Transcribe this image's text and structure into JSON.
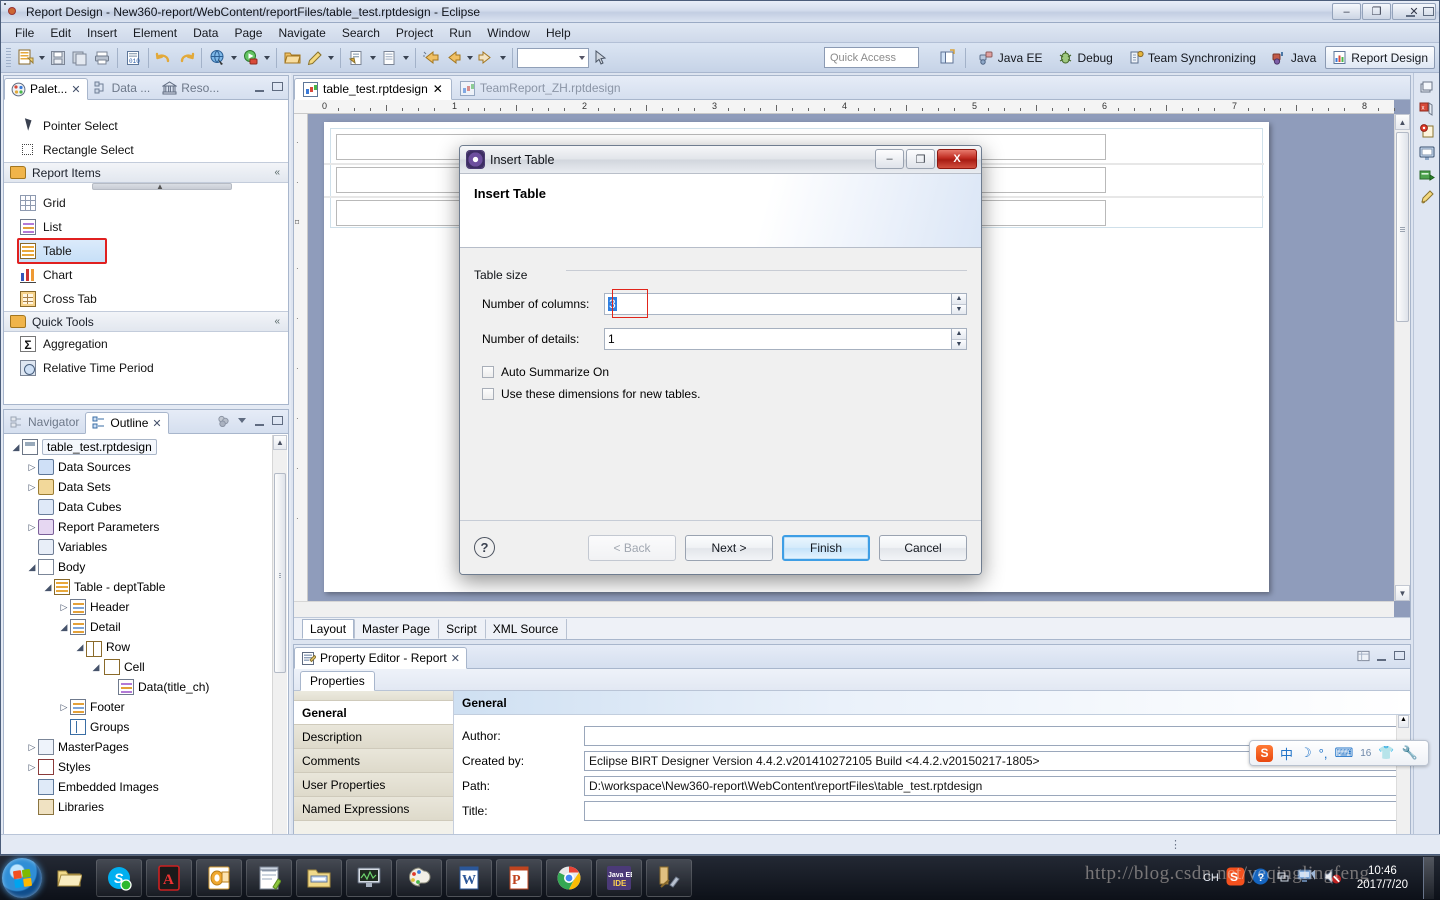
{
  "window": {
    "title": "Report Design - New360-report/WebContent/reportFiles/table_test.rptdesign - Eclipse",
    "minimize": "–",
    "restore": "❐",
    "close": "✕"
  },
  "menu": {
    "items": [
      "File",
      "Edit",
      "Insert",
      "Element",
      "Data",
      "Page",
      "Navigate",
      "Search",
      "Project",
      "Run",
      "Window",
      "Help"
    ]
  },
  "toolbar": {
    "quick_access_placeholder": "Quick Access",
    "perspectives": [
      {
        "label": "Java EE",
        "active": false
      },
      {
        "label": "Debug",
        "active": false
      },
      {
        "label": "Team Synchronizing",
        "active": false
      },
      {
        "label": "Java",
        "active": false
      },
      {
        "label": "Report Design",
        "active": true
      }
    ]
  },
  "palette": {
    "tabs": [
      {
        "label": "Palet...",
        "active": true,
        "closable": true
      },
      {
        "label": "Data ...",
        "active": false,
        "closable": false
      },
      {
        "label": "Reso...",
        "active": false,
        "closable": false
      }
    ],
    "tools": [
      {
        "label": "Pointer Select",
        "icon": "pointer-icon"
      },
      {
        "label": "Rectangle Select",
        "icon": "rectangle-select-icon"
      }
    ],
    "groups": [
      {
        "label": "Report Items",
        "items": [
          {
            "label": "Grid",
            "icon": "grid-icon",
            "selected": false
          },
          {
            "label": "List",
            "icon": "list-icon",
            "selected": false
          },
          {
            "label": "Table",
            "icon": "table-icon",
            "selected": true
          },
          {
            "label": "Chart",
            "icon": "chart-icon",
            "selected": false
          },
          {
            "label": "Cross Tab",
            "icon": "cross-tab-icon",
            "selected": false
          }
        ]
      },
      {
        "label": "Quick Tools",
        "items": [
          {
            "label": "Aggregation",
            "icon": "sigma-icon",
            "selected": false
          },
          {
            "label": "Relative Time Period",
            "icon": "clock-icon",
            "selected": false
          }
        ]
      }
    ]
  },
  "outline": {
    "tabs": [
      {
        "label": "Navigator",
        "active": false
      },
      {
        "label": "Outline",
        "active": true
      }
    ],
    "nodes": [
      {
        "label": "table_test.rptdesign",
        "depth": 0,
        "twist": "open",
        "icon": "report-icon",
        "selected": true
      },
      {
        "label": "Data Sources",
        "depth": 1,
        "twist": "closed",
        "icon": "data-source-icon"
      },
      {
        "label": "Data Sets",
        "depth": 1,
        "twist": "closed",
        "icon": "data-set-icon"
      },
      {
        "label": "Data Cubes",
        "depth": 1,
        "twist": "none",
        "icon": "data-cube-icon"
      },
      {
        "label": "Report Parameters",
        "depth": 1,
        "twist": "closed",
        "icon": "parameter-icon"
      },
      {
        "label": "Variables",
        "depth": 1,
        "twist": "none",
        "icon": "variable-icon"
      },
      {
        "label": "Body",
        "depth": 1,
        "twist": "open",
        "icon": "body-icon"
      },
      {
        "label": "Table - deptTable",
        "depth": 2,
        "twist": "open",
        "icon": "table-icon"
      },
      {
        "label": "Header",
        "depth": 3,
        "twist": "closed",
        "icon": "section-icon"
      },
      {
        "label": "Detail",
        "depth": 3,
        "twist": "open",
        "icon": "section-icon"
      },
      {
        "label": "Row",
        "depth": 4,
        "twist": "open",
        "icon": "row-icon"
      },
      {
        "label": "Cell",
        "depth": 5,
        "twist": "open",
        "icon": "cell-icon"
      },
      {
        "label": "Data(title_ch)",
        "depth": 6,
        "twist": "none",
        "icon": "data-icon"
      },
      {
        "label": "Footer",
        "depth": 3,
        "twist": "closed",
        "icon": "section-icon"
      },
      {
        "label": "Groups",
        "depth": 3,
        "twist": "none",
        "icon": "groups-icon"
      },
      {
        "label": "MasterPages",
        "depth": 1,
        "twist": "closed",
        "icon": "master-page-icon"
      },
      {
        "label": "Styles",
        "depth": 1,
        "twist": "closed",
        "icon": "styles-icon"
      },
      {
        "label": "Embedded Images",
        "depth": 1,
        "twist": "none",
        "icon": "image-icon"
      },
      {
        "label": "Libraries",
        "depth": 1,
        "twist": "none",
        "icon": "library-icon"
      }
    ]
  },
  "editor": {
    "tabs": [
      {
        "label": "table_test.rptdesign",
        "active": true,
        "closable": true
      },
      {
        "label": "TeamReport_ZH.rptdesign",
        "active": false,
        "closable": false
      }
    ],
    "ruler_ticks": [
      "0",
      "1",
      "2",
      "3",
      "4",
      "5",
      "6",
      "7",
      "8"
    ],
    "page_tabs": [
      {
        "label": "Layout",
        "active": true
      },
      {
        "label": "Master Page",
        "active": false
      },
      {
        "label": "Script",
        "active": false
      },
      {
        "label": "XML Source",
        "active": false
      }
    ]
  },
  "property_editor": {
    "view_title": "Property Editor - Report",
    "tab": "Properties",
    "categories": [
      {
        "label": "General",
        "active": true
      },
      {
        "label": "Description",
        "active": false
      },
      {
        "label": "Comments",
        "active": false
      },
      {
        "label": "User Properties",
        "active": false
      },
      {
        "label": "Named Expressions",
        "active": false
      }
    ],
    "section_title": "General",
    "fields": [
      {
        "label": "Author:",
        "value": ""
      },
      {
        "label": "Created by:",
        "value": "Eclipse BIRT Designer Version 4.4.2.v201410272105 Build  <4.4.2.v20150217-1805>"
      },
      {
        "label": "Path:",
        "value": "D:\\workspace\\New360-report\\WebContent\\reportFiles\\table_test.rptdesign"
      },
      {
        "label": "Title:",
        "value": ""
      }
    ]
  },
  "dialog": {
    "title": "Insert Table",
    "heading": "Insert Table",
    "group_label": "Table size",
    "fields": [
      {
        "label": "Number of columns:",
        "value": "3",
        "focused": true
      },
      {
        "label": "Number of details:",
        "value": "1",
        "focused": false
      }
    ],
    "checkboxes": [
      {
        "label": "Auto Summarize On",
        "checked": false
      },
      {
        "label": "Use these dimensions for new tables.",
        "checked": false
      }
    ],
    "buttons": [
      {
        "label": "< Back",
        "state": "disabled"
      },
      {
        "label": "Next >",
        "state": "normal"
      },
      {
        "label": "Finish",
        "state": "default"
      },
      {
        "label": "Cancel",
        "state": "normal"
      }
    ],
    "help": "?",
    "minimize": "–",
    "restore": "❐",
    "close": "X"
  },
  "ime": {
    "logo": "S",
    "items": [
      "中",
      "☽",
      "°,",
      "⌨",
      "16",
      "👕",
      "🔧"
    ]
  },
  "taskbar": {
    "apps": [
      "folder",
      "skype",
      "acrobat",
      "outlook",
      "notepad",
      "explorer",
      "monitor",
      "paint",
      "word",
      "powerpoint",
      "chrome",
      "java-ee-ide",
      "tools"
    ],
    "tray": [
      "CH",
      "sogou",
      "help",
      "network",
      "monitor",
      "volume-muted"
    ],
    "clock_time": "10:46",
    "clock_date": "2017/7/20"
  },
  "watermark": "http://blog.csdn.net/yeqinglingfeng"
}
